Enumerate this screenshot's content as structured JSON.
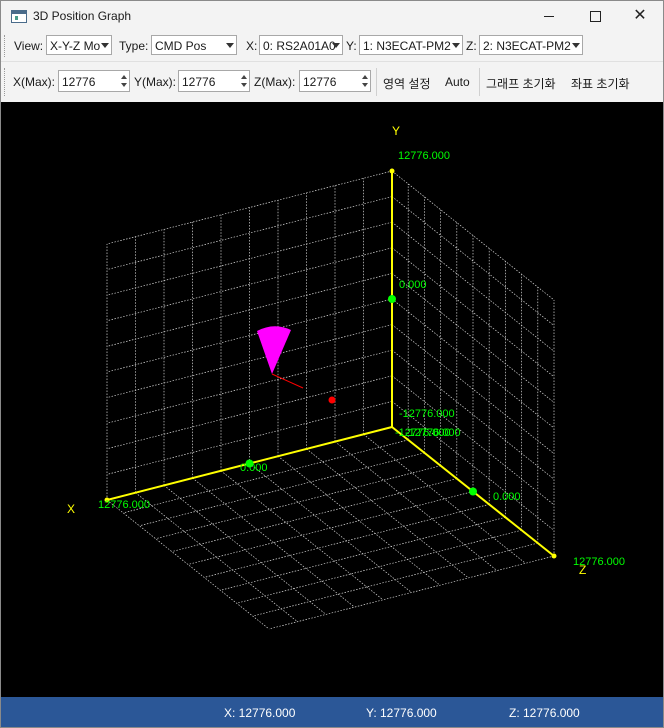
{
  "window": {
    "title": "3D Position Graph"
  },
  "toolbar": {
    "view_label": "View:",
    "view_value": "X-Y-Z Mo",
    "type_label": "Type:",
    "type_value": "CMD Pos",
    "x_label": "X:",
    "x_value": "0: RS2A01A0",
    "y_label": "Y:",
    "y_value": "1: N3ECAT-PM2",
    "z_label": "Z:",
    "z_value": "2: N3ECAT-PM2",
    "xmax_label": "X(Max):",
    "xmax_value": "12776",
    "ymax_label": "Y(Max):",
    "ymax_value": "12776",
    "zmax_label": "Z(Max):",
    "zmax_value": "12776",
    "area_setting": "영역 설정",
    "auto": "Auto",
    "graph_reset": "그래프 초기화",
    "coord_reset": "좌표 초기화"
  },
  "graph": {
    "axis_x_label": "X",
    "axis_y_label": "Y",
    "axis_z_label": "Z",
    "y_max_label": "12776.000",
    "y_mid_label": "0.000",
    "y_min_label": "-12776.000",
    "x_max_label": "12776.000",
    "x_mid_label": "0.000",
    "x_min_label": "-12776.000",
    "z_max_label": "12776.000",
    "z_mid_label": "0.000",
    "z_min_label": "-12776.000",
    "colors": {
      "background": "#000000",
      "grid": "#d8d8d8",
      "axis": "#ffff00",
      "tick_label": "#00ff00",
      "axis_label": "#ffff00",
      "cone": "#ff00ff",
      "point": "#ff0000"
    }
  },
  "status": {
    "x": "X: 12776.000",
    "y": "Y: 12776.000",
    "z": "Z: 12776.000"
  }
}
